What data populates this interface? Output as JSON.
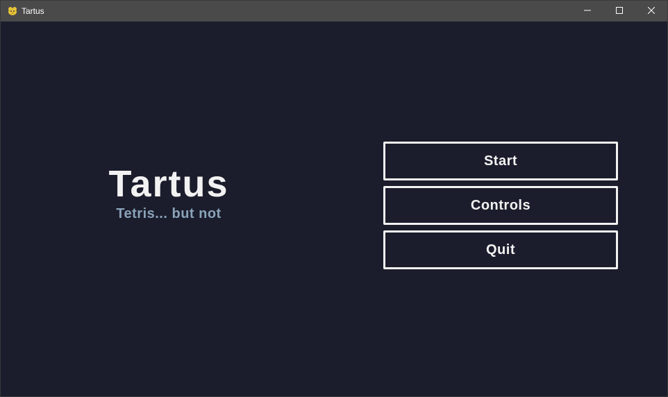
{
  "window": {
    "title": "Tartus",
    "controls": [
      "minimize",
      "maximize",
      "close"
    ]
  },
  "game": {
    "title": "Tartus",
    "tagline": "Tetris... but not"
  },
  "menu": {
    "items": [
      {
        "label": "Start"
      },
      {
        "label": "Controls"
      },
      {
        "label": "Quit"
      }
    ]
  },
  "colors": {
    "background": "#1b1d2c",
    "titlebar": "#4a4a4a",
    "title_text": "#f2f2f2",
    "tagline_text": "#8aa3b8",
    "button_border": "#f2f2f2"
  },
  "icons": {
    "app": "python-snake-icon",
    "minimize": "minimize-icon",
    "maximize": "maximize-icon",
    "close": "close-icon"
  }
}
